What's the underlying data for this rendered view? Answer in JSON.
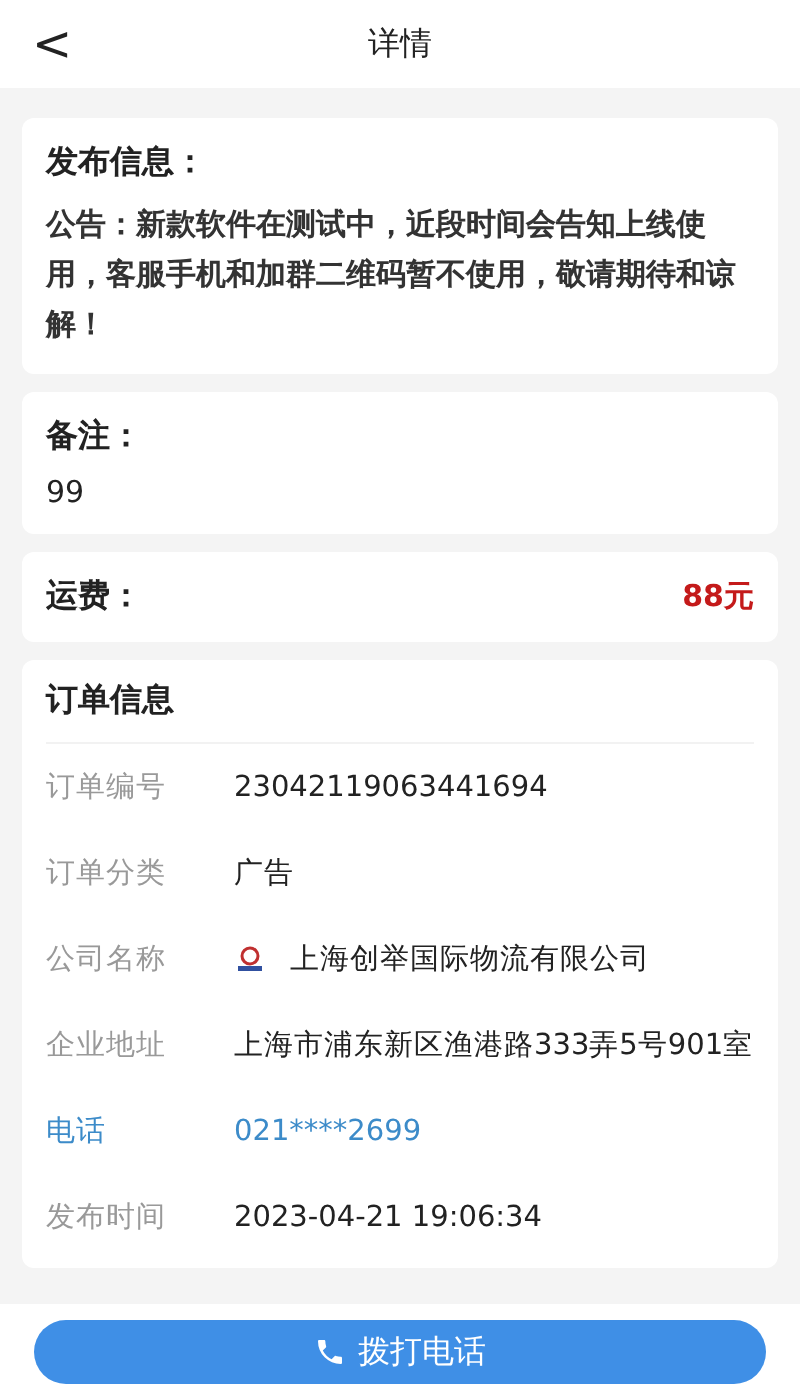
{
  "header": {
    "back": "<",
    "title": "详情"
  },
  "publish": {
    "title": "发布信息：",
    "body": "公告：新款软件在测试中，近段时间会告知上线使用，客服手机和加群二维码暂不使用，敬请期待和谅解！"
  },
  "remark": {
    "title": "备注：",
    "value": "99"
  },
  "freight": {
    "label": "运费：",
    "value": "88元"
  },
  "order": {
    "title": "订单信息",
    "rows": [
      {
        "kind": "text",
        "label": "订单编号",
        "value": "23042119063441694"
      },
      {
        "kind": "text",
        "label": "订单分类",
        "value": "广告"
      },
      {
        "kind": "company",
        "label": "公司名称",
        "value": "上海创举国际物流有限公司"
      },
      {
        "kind": "text",
        "label": "企业地址",
        "value": "上海市浦东新区渔港路333弄5号901室"
      },
      {
        "kind": "phone",
        "label": "电话",
        "value": "021****2699"
      },
      {
        "kind": "text",
        "label": "发布时间",
        "value": "2023-04-21 19:06:34"
      }
    ]
  },
  "call_button": "拨打电话"
}
